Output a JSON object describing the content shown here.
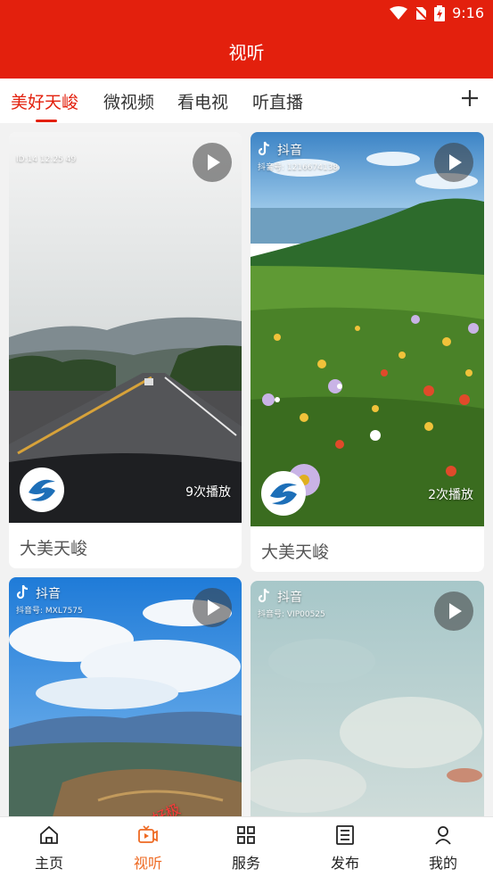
{
  "status": {
    "time": "9:16"
  },
  "header": {
    "title": "视听"
  },
  "tabs": [
    {
      "label": "美好天峻",
      "active": true
    },
    {
      "label": "微视频"
    },
    {
      "label": "看电视"
    },
    {
      "label": "听直播"
    }
  ],
  "cards": [
    {
      "title": "大美天峻",
      "views": "9次播放",
      "watermark_sub": "ID:14 12:25 49"
    },
    {
      "title": "大美天峻",
      "views": "2次播放",
      "watermark": "抖音",
      "watermark_sub": "抖音号: 1216674138"
    },
    {
      "watermark": "抖音",
      "watermark_sub": "抖音号: MXL7575",
      "overlay_text": "好极"
    },
    {
      "watermark": "抖音",
      "watermark_sub": "抖音号: VIP00525"
    }
  ],
  "nav": [
    {
      "label": "主页",
      "icon": "home-icon"
    },
    {
      "label": "视听",
      "icon": "video-icon",
      "active": true
    },
    {
      "label": "服务",
      "icon": "grid-icon"
    },
    {
      "label": "发布",
      "icon": "publish-icon"
    },
    {
      "label": "我的",
      "icon": "user-icon"
    }
  ],
  "colors": {
    "brand": "#e3200d",
    "nav_active": "#ee6a23"
  }
}
